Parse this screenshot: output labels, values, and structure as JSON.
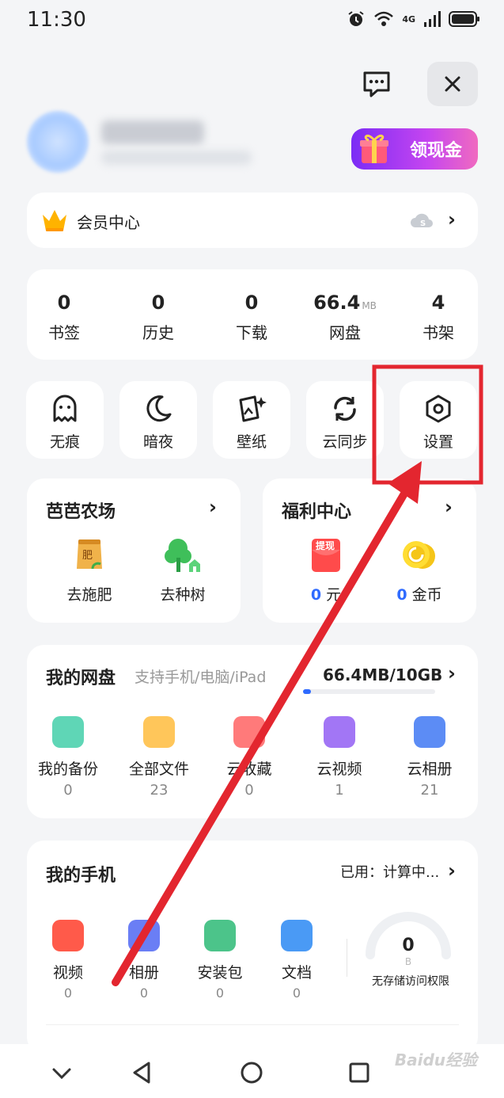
{
  "status_bar": {
    "time": "11:30",
    "network": "4G"
  },
  "header": {
    "gift_button_label": "领现金"
  },
  "vip": {
    "label": "会员中心"
  },
  "stats": [
    {
      "value": "0",
      "unit": "",
      "label": "书签"
    },
    {
      "value": "0",
      "unit": "",
      "label": "历史"
    },
    {
      "value": "0",
      "unit": "",
      "label": "下载"
    },
    {
      "value": "66.4",
      "unit": "MB",
      "label": "网盘"
    },
    {
      "value": "4",
      "unit": "",
      "label": "书架"
    }
  ],
  "quick_tools": [
    {
      "label": "无痕",
      "icon": "ghost-icon"
    },
    {
      "label": "暗夜",
      "icon": "moon-icon"
    },
    {
      "label": "壁纸",
      "icon": "wallpaper-icon"
    },
    {
      "label": "云同步",
      "icon": "sync-icon"
    },
    {
      "label": "设置",
      "icon": "settings-hexagon-icon"
    }
  ],
  "farm": {
    "title": "芭芭农场",
    "items": [
      {
        "label": "去施肥",
        "icon_text": "肥"
      },
      {
        "label": "去种树"
      }
    ]
  },
  "welfare": {
    "title": "福利中心",
    "items": [
      {
        "value": "0",
        "unit": "元",
        "icon_text": "提现"
      },
      {
        "value": "0",
        "unit": "金币"
      }
    ]
  },
  "cloud_drive": {
    "title": "我的网盘",
    "subtitle": "支持手机/电脑/iPad",
    "usage": "66.4MB/10GB",
    "usage_fraction": 0.0065,
    "items": [
      {
        "label": "我的备份",
        "count": "0",
        "color": "#5fd6b6"
      },
      {
        "label": "全部文件",
        "count": "23",
        "color": "#ffc65a"
      },
      {
        "label": "云收藏",
        "count": "0",
        "color": "#ff7a7a"
      },
      {
        "label": "云视频",
        "count": "1",
        "color": "#a276f5"
      },
      {
        "label": "云相册",
        "count": "21",
        "color": "#5c8cf5"
      }
    ]
  },
  "my_phone": {
    "title": "我的手机",
    "used_label": "已用：计算中...",
    "items": [
      {
        "label": "视频",
        "count": "0",
        "color": "#ff5a4a"
      },
      {
        "label": "相册",
        "count": "0",
        "color": "#6a7ef5"
      },
      {
        "label": "安装包",
        "count": "0",
        "color": "#4cc48a"
      },
      {
        "label": "文档",
        "count": "0",
        "color": "#4a9af5"
      }
    ],
    "gauge_value": "0",
    "gauge_unit": "B",
    "gauge_caption": "无存储访问权限"
  },
  "watermark": "Baidu经验",
  "colors": {
    "accent_blue": "#2f6bff",
    "annotation_red": "#e3262f"
  }
}
